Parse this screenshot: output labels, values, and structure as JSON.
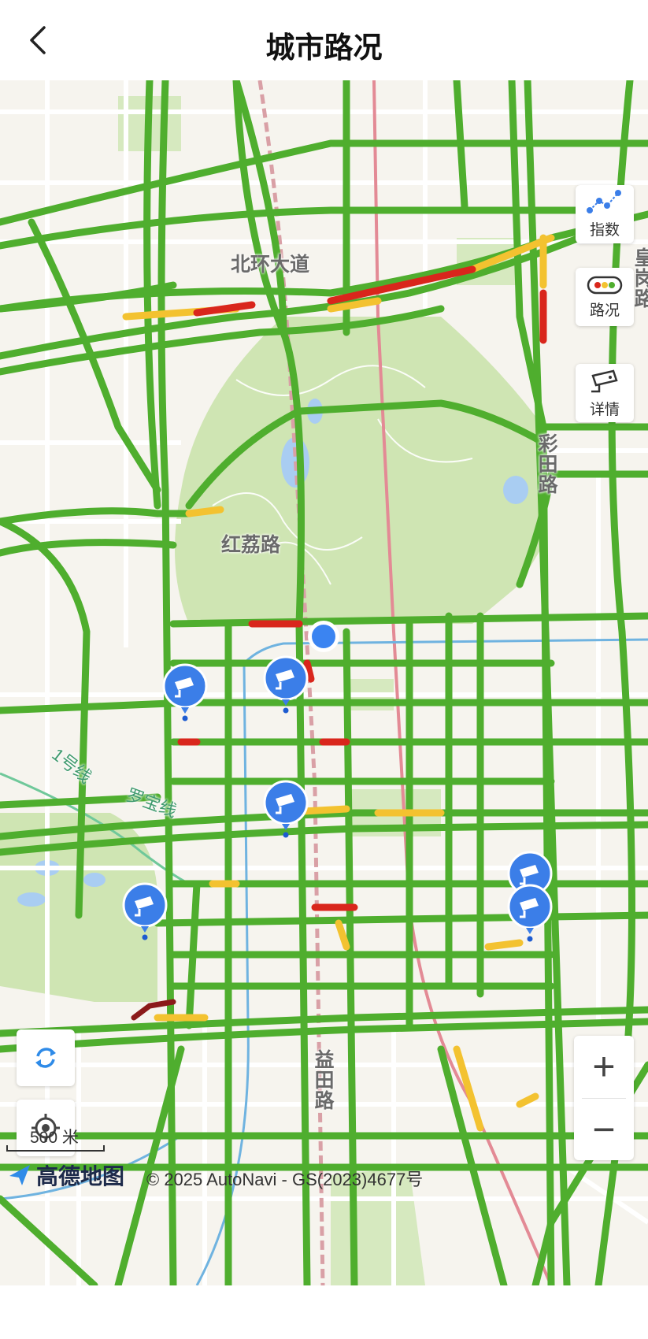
{
  "header": {
    "title": "城市路况",
    "back_icon": "chevron-left-icon"
  },
  "map": {
    "road_labels": {
      "beihuan": "北环大道",
      "hongli": "红荔路",
      "caitian": "彩田路",
      "yitian": "益田路",
      "huanggang": "皇岗路"
    },
    "metro_labels": {
      "line1": "1号线",
      "luobao": "罗宝线"
    },
    "side_buttons": [
      {
        "label": "指数",
        "icon": "trend-chart-icon"
      },
      {
        "label": "路况",
        "icon": "traffic-light-icon"
      },
      {
        "label": "详情",
        "icon": "camera-icon"
      }
    ],
    "controls": {
      "refresh_icon": "refresh-icon",
      "locate_icon": "locate-icon",
      "zoom_in": "+",
      "zoom_out": "−"
    },
    "scale": "500 米",
    "logo_text": "高德地图",
    "copyright": "© 2025 AutoNavi - GS(2023)4677号",
    "colors": {
      "smooth": "#4fae2e",
      "slow": "#f3c230",
      "jam": "#d9261c",
      "severe": "#8b1a1a",
      "park": "#cfe5b3",
      "water": "#a9cdf2",
      "camera": "#3b7ee8",
      "location": "#3b84f1"
    },
    "camera_count": 7
  }
}
